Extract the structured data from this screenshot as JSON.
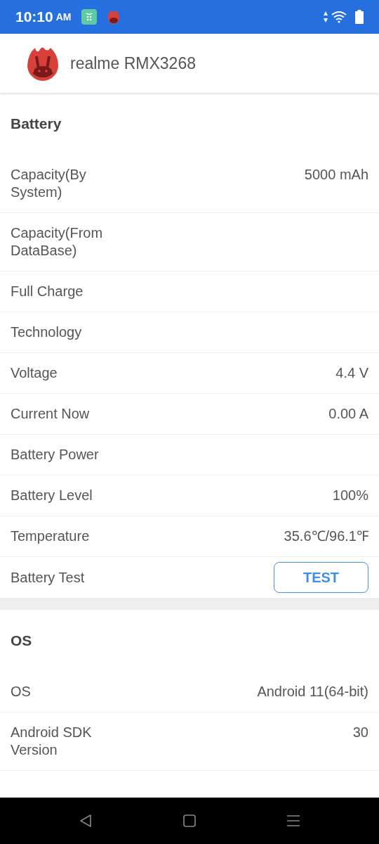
{
  "status_bar": {
    "time": "10:10",
    "ampm": "AM"
  },
  "header": {
    "title": "realme RMX3268"
  },
  "sections": [
    {
      "title": "Battery",
      "rows": [
        {
          "kind": "value",
          "label": "Capacity(By System)",
          "value": "5000 mAh"
        },
        {
          "kind": "value",
          "label": "Capacity(From DataBase)"
        },
        {
          "kind": "value",
          "label": "Full Charge"
        },
        {
          "kind": "value",
          "label": "Technology"
        },
        {
          "kind": "value",
          "label": "Voltage",
          "value": "4.4 V"
        },
        {
          "kind": "value",
          "label": "Current Now",
          "value": "0.00 A"
        },
        {
          "kind": "value",
          "label": "Battery Power"
        },
        {
          "kind": "value",
          "label": "Battery Level",
          "value": "100%"
        },
        {
          "kind": "value",
          "label": "Temperature",
          "value": "35.6℃/96.1℉"
        },
        {
          "kind": "button",
          "label": "Battery Test",
          "button": "TEST"
        }
      ]
    },
    {
      "title": "OS",
      "rows": [
        {
          "kind": "value",
          "label": "OS",
          "value": "Android 11(64-bit)"
        },
        {
          "kind": "value",
          "label": "Android SDK Version",
          "value": "30"
        }
      ]
    }
  ]
}
